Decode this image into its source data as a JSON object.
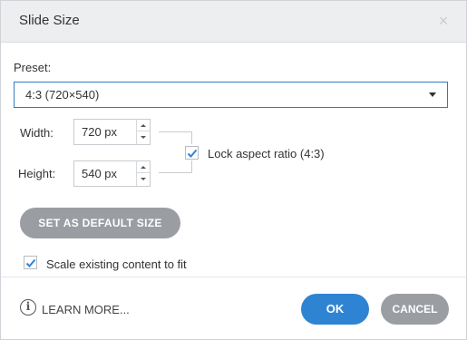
{
  "dialog": {
    "title": "Slide Size",
    "close_glyph": "×"
  },
  "preset": {
    "label": "Preset:",
    "selected": "4:3 (720×540)"
  },
  "width": {
    "label": "Width:",
    "value": "720 px"
  },
  "height": {
    "label": "Height:",
    "value": "540 px"
  },
  "lock_aspect": {
    "label": "Lock aspect ratio (4:3)",
    "checked": true
  },
  "set_default_button": "SET AS DEFAULT SIZE",
  "scale_content": {
    "label": "Scale existing content to fit",
    "checked": true
  },
  "footer": {
    "info_glyph": "i",
    "learn_more": "LEARN MORE...",
    "ok_button": "OK",
    "cancel_button": "CANCEL"
  },
  "colors": {
    "accent": "#2e84d2",
    "check": "#2e84d2",
    "secondary_button": "#9a9ea3"
  },
  "icons": {
    "close": "close-icon",
    "dropdown": "chevron-down-icon",
    "check": "checkmark-icon",
    "info": "info-icon"
  }
}
